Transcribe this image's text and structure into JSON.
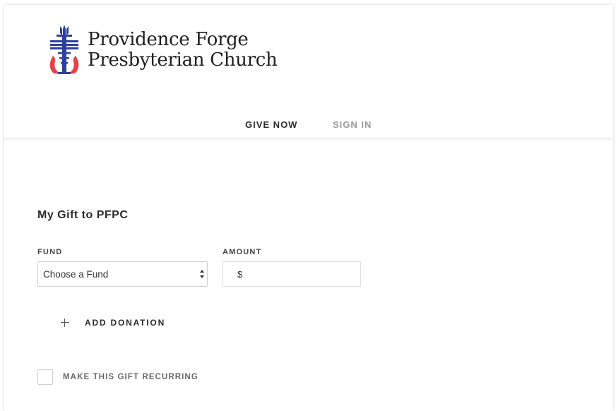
{
  "header": {
    "org_name_line1": "Providence Forge",
    "org_name_line2": "Presbyterian Church",
    "logo_icon": "presbyterian-cross-icon",
    "nav": [
      {
        "label": "GIVE NOW",
        "active": true
      },
      {
        "label": "SIGN IN",
        "active": false
      }
    ]
  },
  "form": {
    "title": "My Gift to PFPC",
    "fund": {
      "label": "FUND",
      "selected": "Choose a Fund"
    },
    "amount": {
      "label": "AMOUNT",
      "prefix": "$",
      "value": ""
    },
    "add_donation_label": "ADD DONATION",
    "recurring_label": "MAKE THIS GIFT RECURRING",
    "recurring_checked": false
  },
  "colors": {
    "logo_blue": "#2e3f9c",
    "logo_red": "#e8404a",
    "text_dark": "#2b2b2b",
    "text_muted": "#9a9a9a"
  }
}
